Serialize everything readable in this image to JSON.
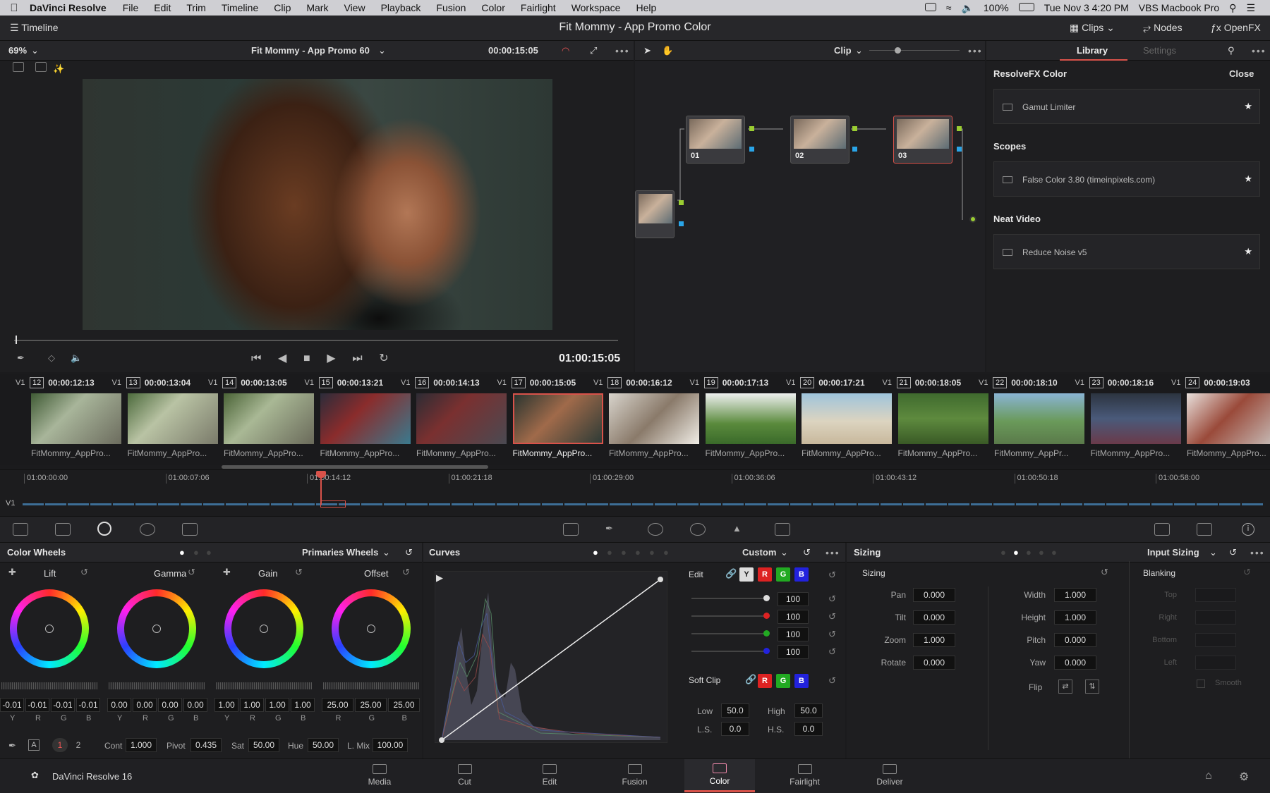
{
  "menubar": {
    "app": "DaVinci Resolve",
    "items": [
      "File",
      "Edit",
      "Trim",
      "Timeline",
      "Clip",
      "Mark",
      "View",
      "Playback",
      "Fusion",
      "Color",
      "Fairlight",
      "Workspace",
      "Help"
    ],
    "battery": "100%",
    "datetime": "Tue Nov 3  4:20 PM",
    "machine": "VBS Macbook Pro"
  },
  "titlebar": {
    "timeline_label": "Timeline",
    "project_title": "Fit Mommy - App Promo Color",
    "clips_label": "Clips",
    "nodes_label": "Nodes",
    "openfx_label": "OpenFX"
  },
  "viewer": {
    "zoom": "69%",
    "timeline_name": "Fit Mommy - App Promo 60",
    "timecode_top": "00:00:15:05",
    "timecode_main": "01:00:15:05"
  },
  "node_editor": {
    "mode": "Clip",
    "nodes": [
      {
        "label": "01"
      },
      {
        "label": "02"
      },
      {
        "label": "03"
      }
    ]
  },
  "library": {
    "tab_library": "Library",
    "tab_settings": "Settings",
    "close": "Close",
    "sections": [
      {
        "title": "ResolveFX Color",
        "item": "Gamut Limiter"
      },
      {
        "title": "Scopes",
        "item": "False Color 3.80 (timeinpixels.com)"
      },
      {
        "title": "Neat Video",
        "item": "Reduce Noise v5"
      }
    ]
  },
  "clips": [
    {
      "num": "12",
      "tc": "00:00:12:13",
      "track": "V1",
      "name": "FitMommy_AppPro..."
    },
    {
      "num": "13",
      "tc": "00:00:13:04",
      "track": "V1",
      "name": "FitMommy_AppPro..."
    },
    {
      "num": "14",
      "tc": "00:00:13:05",
      "track": "V1",
      "name": "FitMommy_AppPro..."
    },
    {
      "num": "15",
      "tc": "00:00:13:21",
      "track": "V1",
      "name": "FitMommy_AppPro..."
    },
    {
      "num": "16",
      "tc": "00:00:14:13",
      "track": "V1",
      "name": "FitMommy_AppPro..."
    },
    {
      "num": "17",
      "tc": "00:00:15:05",
      "track": "V1",
      "name": "FitMommy_AppPro..."
    },
    {
      "num": "18",
      "tc": "00:00:16:12",
      "track": "V1",
      "name": "FitMommy_AppPro..."
    },
    {
      "num": "19",
      "tc": "00:00:17:13",
      "track": "V1",
      "name": "FitMommy_AppPro..."
    },
    {
      "num": "20",
      "tc": "00:00:17:21",
      "track": "V1",
      "name": "FitMommy_AppPro..."
    },
    {
      "num": "21",
      "tc": "00:00:18:05",
      "track": "V1",
      "name": "FitMommy_AppPro..."
    },
    {
      "num": "22",
      "tc": "00:00:18:10",
      "track": "V1",
      "name": "FitMommy_AppPr..."
    },
    {
      "num": "23",
      "tc": "00:00:18:16",
      "track": "V1",
      "name": "FitMommy_AppPro..."
    },
    {
      "num": "24",
      "tc": "00:00:19:03",
      "track": "V1",
      "name": "FitMommy_AppPro..."
    }
  ],
  "ruler": {
    "track": "V1",
    "ticks": [
      "01:00:00:00",
      "01:00:07:06",
      "01:00:14:12",
      "01:00:21:18",
      "01:00:29:00",
      "01:00:36:06",
      "01:00:43:12",
      "01:00:50:18",
      "01:00:58:00"
    ]
  },
  "color_wheels": {
    "title": "Color Wheels",
    "mode": "Primaries Wheels",
    "wheels": [
      {
        "name": "Lift",
        "values": [
          "-0.01",
          "-0.01",
          "-0.01",
          "-0.01"
        ],
        "chan": [
          "Y",
          "R",
          "G",
          "B"
        ]
      },
      {
        "name": "Gamma",
        "values": [
          "0.00",
          "0.00",
          "0.00",
          "0.00"
        ],
        "chan": [
          "Y",
          "R",
          "G",
          "B"
        ]
      },
      {
        "name": "Gain",
        "values": [
          "1.00",
          "1.00",
          "1.00",
          "1.00"
        ],
        "chan": [
          "Y",
          "R",
          "G",
          "B"
        ]
      },
      {
        "name": "Offset",
        "values": [
          "25.00",
          "25.00",
          "25.00"
        ],
        "chan": [
          "R",
          "G",
          "B"
        ]
      }
    ],
    "footer": {
      "page1": "1",
      "page2": "2",
      "cont_label": "Cont",
      "cont": "1.000",
      "pivot_label": "Pivot",
      "pivot": "0.435",
      "sat_label": "Sat",
      "sat": "50.00",
      "hue_label": "Hue",
      "hue": "50.00",
      "lmix_label": "L. Mix",
      "lmix": "100.00"
    }
  },
  "curves": {
    "title": "Curves",
    "mode": "Custom",
    "edit_label": "Edit",
    "y_label": "Y",
    "r_label": "R",
    "g_label": "G",
    "b_label": "B",
    "intensities": [
      "100",
      "100",
      "100",
      "100"
    ],
    "softclip_label": "Soft Clip",
    "low_label": "Low",
    "low": "50.0",
    "high_label": "High",
    "high": "50.0",
    "ls_label": "L.S.",
    "ls": "0.0",
    "hs_label": "H.S.",
    "hs": "0.0"
  },
  "sizing": {
    "title": "Sizing",
    "mode": "Input Sizing",
    "sub": "Sizing",
    "fields_left": [
      {
        "label": "Pan",
        "value": "0.000"
      },
      {
        "label": "Tilt",
        "value": "0.000"
      },
      {
        "label": "Zoom",
        "value": "1.000"
      },
      {
        "label": "Rotate",
        "value": "0.000"
      }
    ],
    "fields_right": [
      {
        "label": "Width",
        "value": "1.000"
      },
      {
        "label": "Height",
        "value": "1.000"
      },
      {
        "label": "Pitch",
        "value": "0.000"
      },
      {
        "label": "Yaw",
        "value": "0.000"
      }
    ],
    "flip_label": "Flip",
    "blanking": "Blanking",
    "blank_fields": [
      "Top",
      "Right",
      "Bottom",
      "Left"
    ],
    "smooth": "Smooth"
  },
  "bottom_nav": {
    "brand": "DaVinci Resolve 16",
    "pages": [
      "Media",
      "Cut",
      "Edit",
      "Fusion",
      "Color",
      "Fairlight",
      "Deliver"
    ],
    "active": "Color"
  },
  "colors": {
    "accent_red": "#d9524a",
    "node_green": "#9acd32",
    "node_blue": "#2aa5e8"
  }
}
